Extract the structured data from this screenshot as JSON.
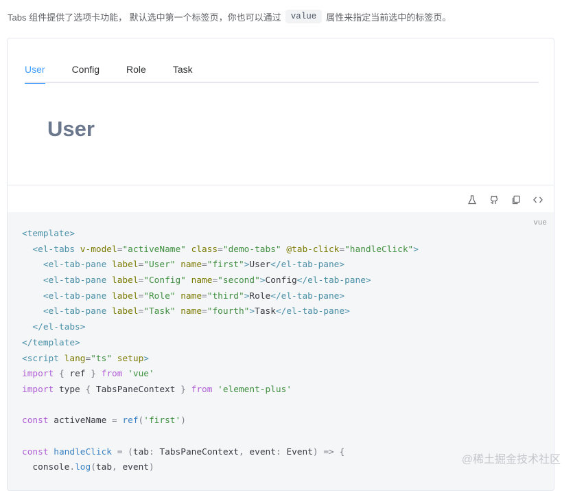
{
  "intro": {
    "before": "Tabs 组件提供了选项卡功能， 默认选中第一个标签页，你也可以通过",
    "code": "value",
    "after": "属性来指定当前选中的标签页。"
  },
  "tabs": [
    {
      "label": "User",
      "active": true
    },
    {
      "label": "Config",
      "active": false
    },
    {
      "label": "Role",
      "active": false
    },
    {
      "label": "Task",
      "active": false
    }
  ],
  "pane": {
    "content": "User"
  },
  "op_icons": [
    "flask-icon",
    "github-icon",
    "copy-icon",
    "code-icon"
  ],
  "code": {
    "lang": "vue",
    "lines": [
      [
        [
          "tag",
          "<template>"
        ]
      ],
      [
        [
          "plain",
          "  "
        ],
        [
          "tag",
          "<el-tabs"
        ],
        [
          "plain",
          " "
        ],
        [
          "attr",
          "v-model"
        ],
        [
          "punc",
          "="
        ],
        [
          "str",
          "\"activeName\""
        ],
        [
          "plain",
          " "
        ],
        [
          "attr",
          "class"
        ],
        [
          "punc",
          "="
        ],
        [
          "str",
          "\"demo-tabs\""
        ],
        [
          "plain",
          " "
        ],
        [
          "attr",
          "@tab-click"
        ],
        [
          "punc",
          "="
        ],
        [
          "str",
          "\"handleClick\""
        ],
        [
          "tag",
          ">"
        ]
      ],
      [
        [
          "plain",
          "    "
        ],
        [
          "tag",
          "<el-tab-pane"
        ],
        [
          "plain",
          " "
        ],
        [
          "attr",
          "label"
        ],
        [
          "punc",
          "="
        ],
        [
          "str",
          "\"User\""
        ],
        [
          "plain",
          " "
        ],
        [
          "attr",
          "name"
        ],
        [
          "punc",
          "="
        ],
        [
          "str",
          "\"first\""
        ],
        [
          "tag",
          ">"
        ],
        [
          "plain",
          "User"
        ],
        [
          "tag",
          "</el-tab-pane>"
        ]
      ],
      [
        [
          "plain",
          "    "
        ],
        [
          "tag",
          "<el-tab-pane"
        ],
        [
          "plain",
          " "
        ],
        [
          "attr",
          "label"
        ],
        [
          "punc",
          "="
        ],
        [
          "str",
          "\"Config\""
        ],
        [
          "plain",
          " "
        ],
        [
          "attr",
          "name"
        ],
        [
          "punc",
          "="
        ],
        [
          "str",
          "\"second\""
        ],
        [
          "tag",
          ">"
        ],
        [
          "plain",
          "Config"
        ],
        [
          "tag",
          "</el-tab-pane>"
        ]
      ],
      [
        [
          "plain",
          "    "
        ],
        [
          "tag",
          "<el-tab-pane"
        ],
        [
          "plain",
          " "
        ],
        [
          "attr",
          "label"
        ],
        [
          "punc",
          "="
        ],
        [
          "str",
          "\"Role\""
        ],
        [
          "plain",
          " "
        ],
        [
          "attr",
          "name"
        ],
        [
          "punc",
          "="
        ],
        [
          "str",
          "\"third\""
        ],
        [
          "tag",
          ">"
        ],
        [
          "plain",
          "Role"
        ],
        [
          "tag",
          "</el-tab-pane>"
        ]
      ],
      [
        [
          "plain",
          "    "
        ],
        [
          "tag",
          "<el-tab-pane"
        ],
        [
          "plain",
          " "
        ],
        [
          "attr",
          "label"
        ],
        [
          "punc",
          "="
        ],
        [
          "str",
          "\"Task\""
        ],
        [
          "plain",
          " "
        ],
        [
          "attr",
          "name"
        ],
        [
          "punc",
          "="
        ],
        [
          "str",
          "\"fourth\""
        ],
        [
          "tag",
          ">"
        ],
        [
          "plain",
          "Task"
        ],
        [
          "tag",
          "</el-tab-pane>"
        ]
      ],
      [
        [
          "plain",
          "  "
        ],
        [
          "tag",
          "</el-tabs>"
        ]
      ],
      [
        [
          "tag",
          "</template>"
        ]
      ],
      [
        [
          "tag",
          "<script"
        ],
        [
          "plain",
          " "
        ],
        [
          "attr",
          "lang"
        ],
        [
          "punc",
          "="
        ],
        [
          "str",
          "\"ts\""
        ],
        [
          "plain",
          " "
        ],
        [
          "attr",
          "setup"
        ],
        [
          "tag",
          ">"
        ]
      ],
      [
        [
          "kw",
          "import"
        ],
        [
          "plain",
          " "
        ],
        [
          "punc",
          "{"
        ],
        [
          "plain",
          " ref "
        ],
        [
          "punc",
          "}"
        ],
        [
          "plain",
          " "
        ],
        [
          "kw",
          "from"
        ],
        [
          "plain",
          " "
        ],
        [
          "str",
          "'vue'"
        ]
      ],
      [
        [
          "kw",
          "import"
        ],
        [
          "plain",
          " type "
        ],
        [
          "punc",
          "{"
        ],
        [
          "plain",
          " TabsPaneContext "
        ],
        [
          "punc",
          "}"
        ],
        [
          "plain",
          " "
        ],
        [
          "kw",
          "from"
        ],
        [
          "plain",
          " "
        ],
        [
          "str",
          "'element-plus'"
        ]
      ],
      [
        [
          "plain",
          ""
        ]
      ],
      [
        [
          "kw",
          "const"
        ],
        [
          "plain",
          " activeName "
        ],
        [
          "punc",
          "="
        ],
        [
          "plain",
          " "
        ],
        [
          "fn",
          "ref"
        ],
        [
          "punc",
          "("
        ],
        [
          "str",
          "'first'"
        ],
        [
          "punc",
          ")"
        ]
      ],
      [
        [
          "plain",
          ""
        ]
      ],
      [
        [
          "kw",
          "const"
        ],
        [
          "plain",
          " "
        ],
        [
          "fn",
          "handleClick"
        ],
        [
          "plain",
          " "
        ],
        [
          "punc",
          "="
        ],
        [
          "plain",
          " "
        ],
        [
          "punc",
          "("
        ],
        [
          "plain",
          "tab"
        ],
        [
          "punc",
          ":"
        ],
        [
          "plain",
          " TabsPaneContext"
        ],
        [
          "punc",
          ","
        ],
        [
          "plain",
          " event"
        ],
        [
          "punc",
          ":"
        ],
        [
          "plain",
          " Event"
        ],
        [
          "punc",
          ")"
        ],
        [
          "plain",
          " "
        ],
        [
          "punc",
          "=>"
        ],
        [
          "plain",
          " "
        ],
        [
          "punc",
          "{"
        ]
      ],
      [
        [
          "plain",
          "  console"
        ],
        [
          "punc",
          "."
        ],
        [
          "fn",
          "log"
        ],
        [
          "punc",
          "("
        ],
        [
          "plain",
          "tab"
        ],
        [
          "punc",
          ","
        ],
        [
          "plain",
          " event"
        ],
        [
          "punc",
          ")"
        ]
      ]
    ]
  },
  "watermark": "@稀土掘金技术社区"
}
